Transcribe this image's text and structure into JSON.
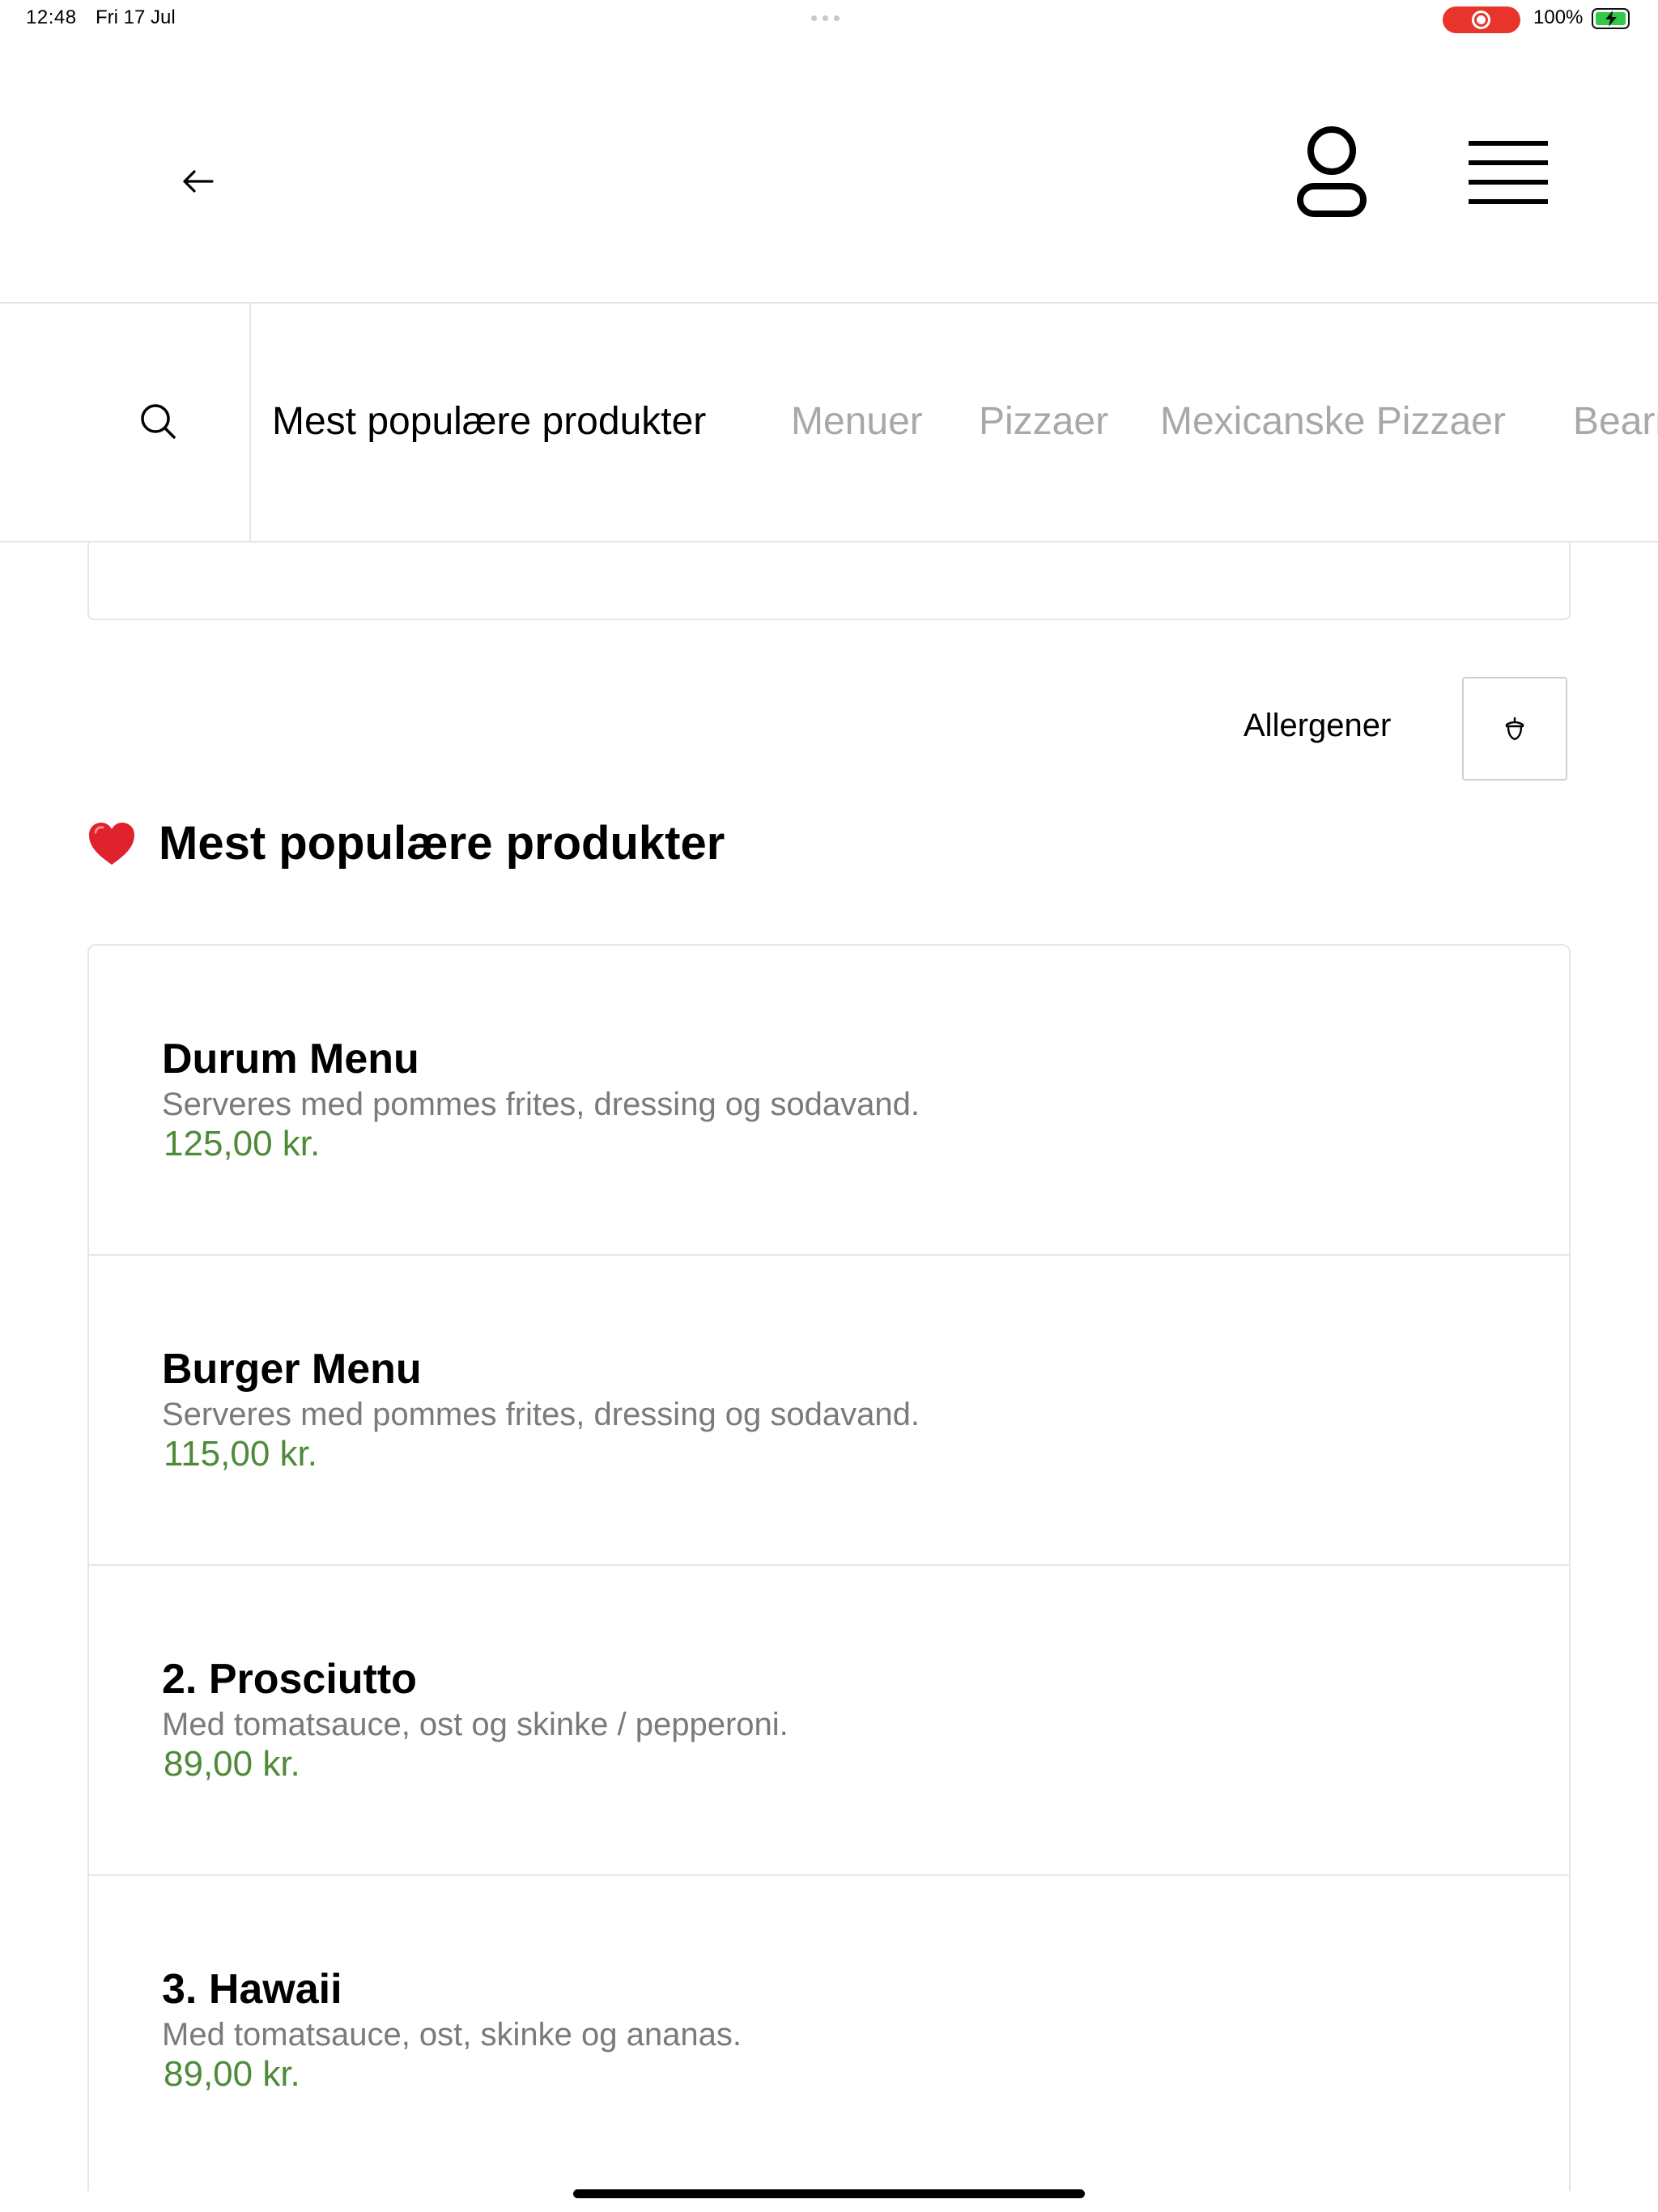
{
  "status_bar": {
    "time": "12:48",
    "date": "Fri 17 Jul",
    "battery_percent": "100%",
    "recording_color": "#e8352b",
    "battery_color": "#33c84a"
  },
  "header": {
    "back_icon": "arrow-left-icon",
    "user_icon": "user-icon",
    "menu_icon": "hamburger-menu-icon"
  },
  "categories": {
    "search_icon": "search-icon",
    "items": [
      {
        "label": "Mest populære produkter",
        "active": true
      },
      {
        "label": "Menuer",
        "active": false
      },
      {
        "label": "Pizzaer",
        "active": false
      },
      {
        "label": "Mexicanske Pizzaer",
        "active": false
      },
      {
        "label": "Bearnaise Pizzaer",
        "active": false
      }
    ]
  },
  "allergens": {
    "label": "Allergener",
    "icon": "acorn-icon"
  },
  "section": {
    "emoji": "heart-icon",
    "title": "Mest populære produkter"
  },
  "products": [
    {
      "name": "Durum Menu",
      "description": "Serveres med pommes frites, dressing og sodavand.",
      "price": "125,00 kr."
    },
    {
      "name": "Burger Menu",
      "description": "Serveres med pommes frites, dressing og sodavand.",
      "price": "115,00 kr."
    },
    {
      "name": "2. Prosciutto",
      "description": "Med tomatsauce, ost og skinke / pepperoni.",
      "price": "89,00 kr."
    },
    {
      "name": "3. Hawaii",
      "description": "Med tomatsauce, ost, skinke og ananas.",
      "price": "89,00 kr."
    }
  ],
  "colors": {
    "price": "#4f8a3a",
    "muted_text": "#7a7a7a",
    "inactive_category": "#a8a8a8",
    "heart": "#e0212e"
  }
}
